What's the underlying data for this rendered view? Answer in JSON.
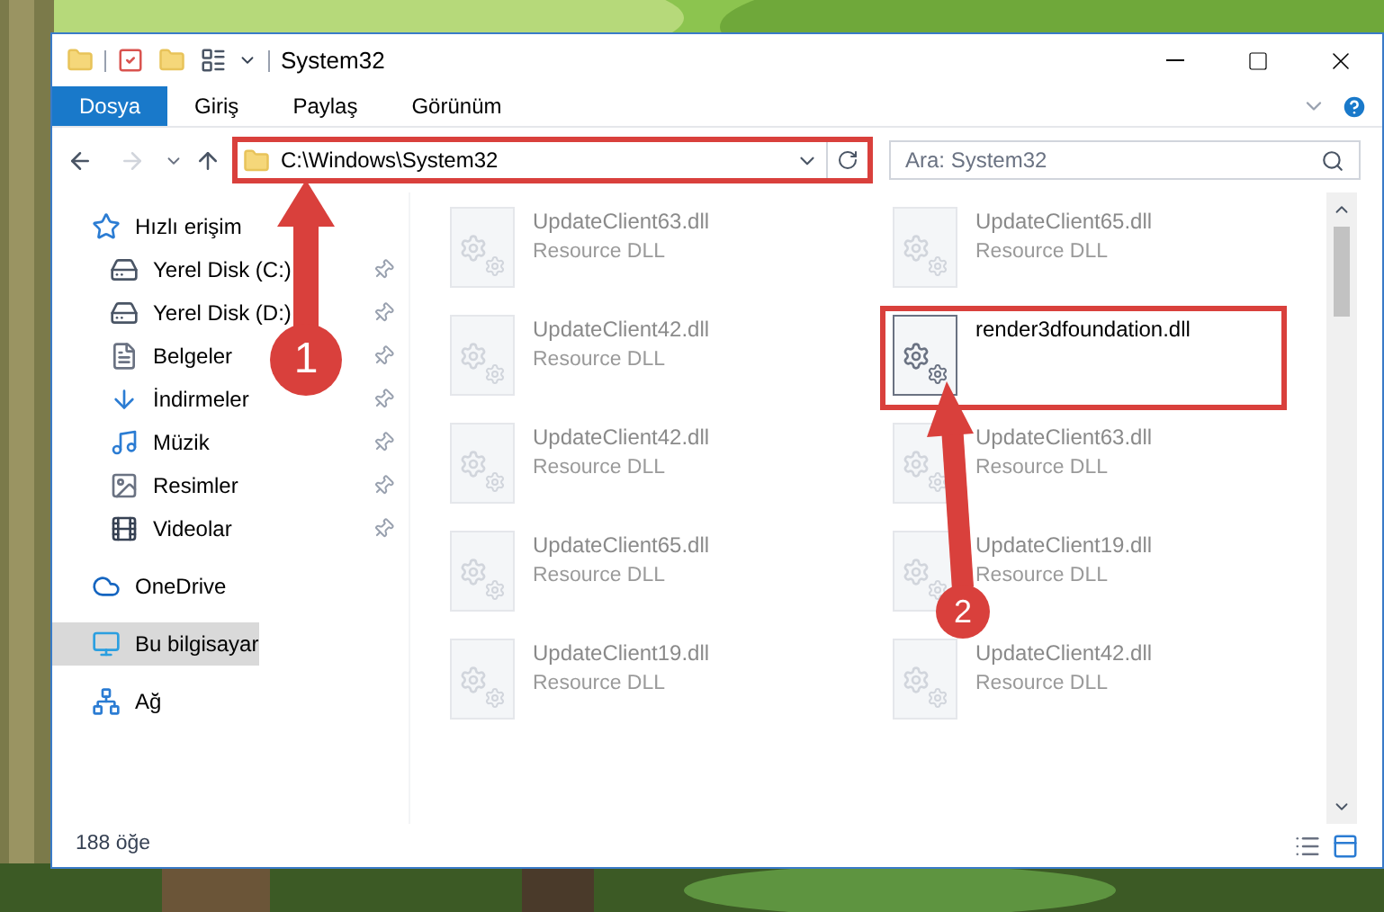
{
  "window": {
    "title": "System32"
  },
  "ribbon_tabs": [
    {
      "label": "Dosya",
      "selected": true
    },
    {
      "label": "Giriş",
      "selected": false
    },
    {
      "label": "Paylaş",
      "selected": false
    },
    {
      "label": "Görünüm",
      "selected": false
    }
  ],
  "address": {
    "path": "C:\\Windows\\System32",
    "highlighted": true
  },
  "search": {
    "placeholder": "Ara: System32"
  },
  "sidebar": {
    "items": [
      {
        "label": "Hızlı erişim",
        "kind": "star",
        "selected": false,
        "children": [
          {
            "label": "Yerel Disk (C:)",
            "kind": "drive-c",
            "selected": false,
            "pinned": true
          },
          {
            "label": "Yerel Disk (D:)",
            "kind": "drive",
            "selected": false,
            "pinned": true
          },
          {
            "label": "Belgeler",
            "kind": "documents",
            "selected": false,
            "pinned": true
          },
          {
            "label": "İndirmeler",
            "kind": "downloads",
            "selected": false,
            "pinned": true
          },
          {
            "label": "Müzik",
            "kind": "music",
            "selected": false,
            "pinned": true
          },
          {
            "label": "Resimler",
            "kind": "pictures",
            "selected": false,
            "pinned": true
          },
          {
            "label": "Videolar",
            "kind": "videos",
            "selected": false,
            "pinned": true
          }
        ]
      },
      {
        "label": "OneDrive",
        "kind": "cloud",
        "selected": false
      },
      {
        "label": "Bu bilgisayar",
        "kind": "computer",
        "selected": true
      },
      {
        "label": "Ağ",
        "kind": "network",
        "selected": false
      }
    ]
  },
  "files": [
    {
      "name": "UpdateClient63.dll",
      "type": "Resource DLL",
      "dimmed": true,
      "highlighted": false
    },
    {
      "name": "UpdateClient65.dll",
      "type": "Resource DLL",
      "dimmed": true,
      "highlighted": false
    },
    {
      "name": "UpdateClient42.dll",
      "type": "Resource DLL",
      "dimmed": true,
      "highlighted": false
    },
    {
      "name": "render3dfoundation.dll",
      "dimmed": false,
      "highlighted": true
    },
    {
      "name": "UpdateClient42.dll",
      "type": "Resource DLL",
      "dimmed": true,
      "highlighted": false
    },
    {
      "name": "UpdateClient63.dll",
      "type": "Resource DLL",
      "dimmed": true,
      "highlighted": false
    },
    {
      "name": "UpdateClient65.dll",
      "type": "Resource DLL",
      "dimmed": true,
      "highlighted": false
    },
    {
      "name": "UpdateClient19.dll",
      "type": "Resource DLL",
      "dimmed": true,
      "highlighted": false
    },
    {
      "name": "UpdateClient19.dll",
      "type": "Resource DLL",
      "dimmed": true,
      "highlighted": false
    },
    {
      "name": "UpdateClient42.dll",
      "type": "Resource DLL",
      "dimmed": true,
      "highlighted": false
    }
  ],
  "status_bar": {
    "count": "188 öğe"
  },
  "annotations": [
    {
      "number": "1"
    },
    {
      "number": "2"
    }
  ]
}
